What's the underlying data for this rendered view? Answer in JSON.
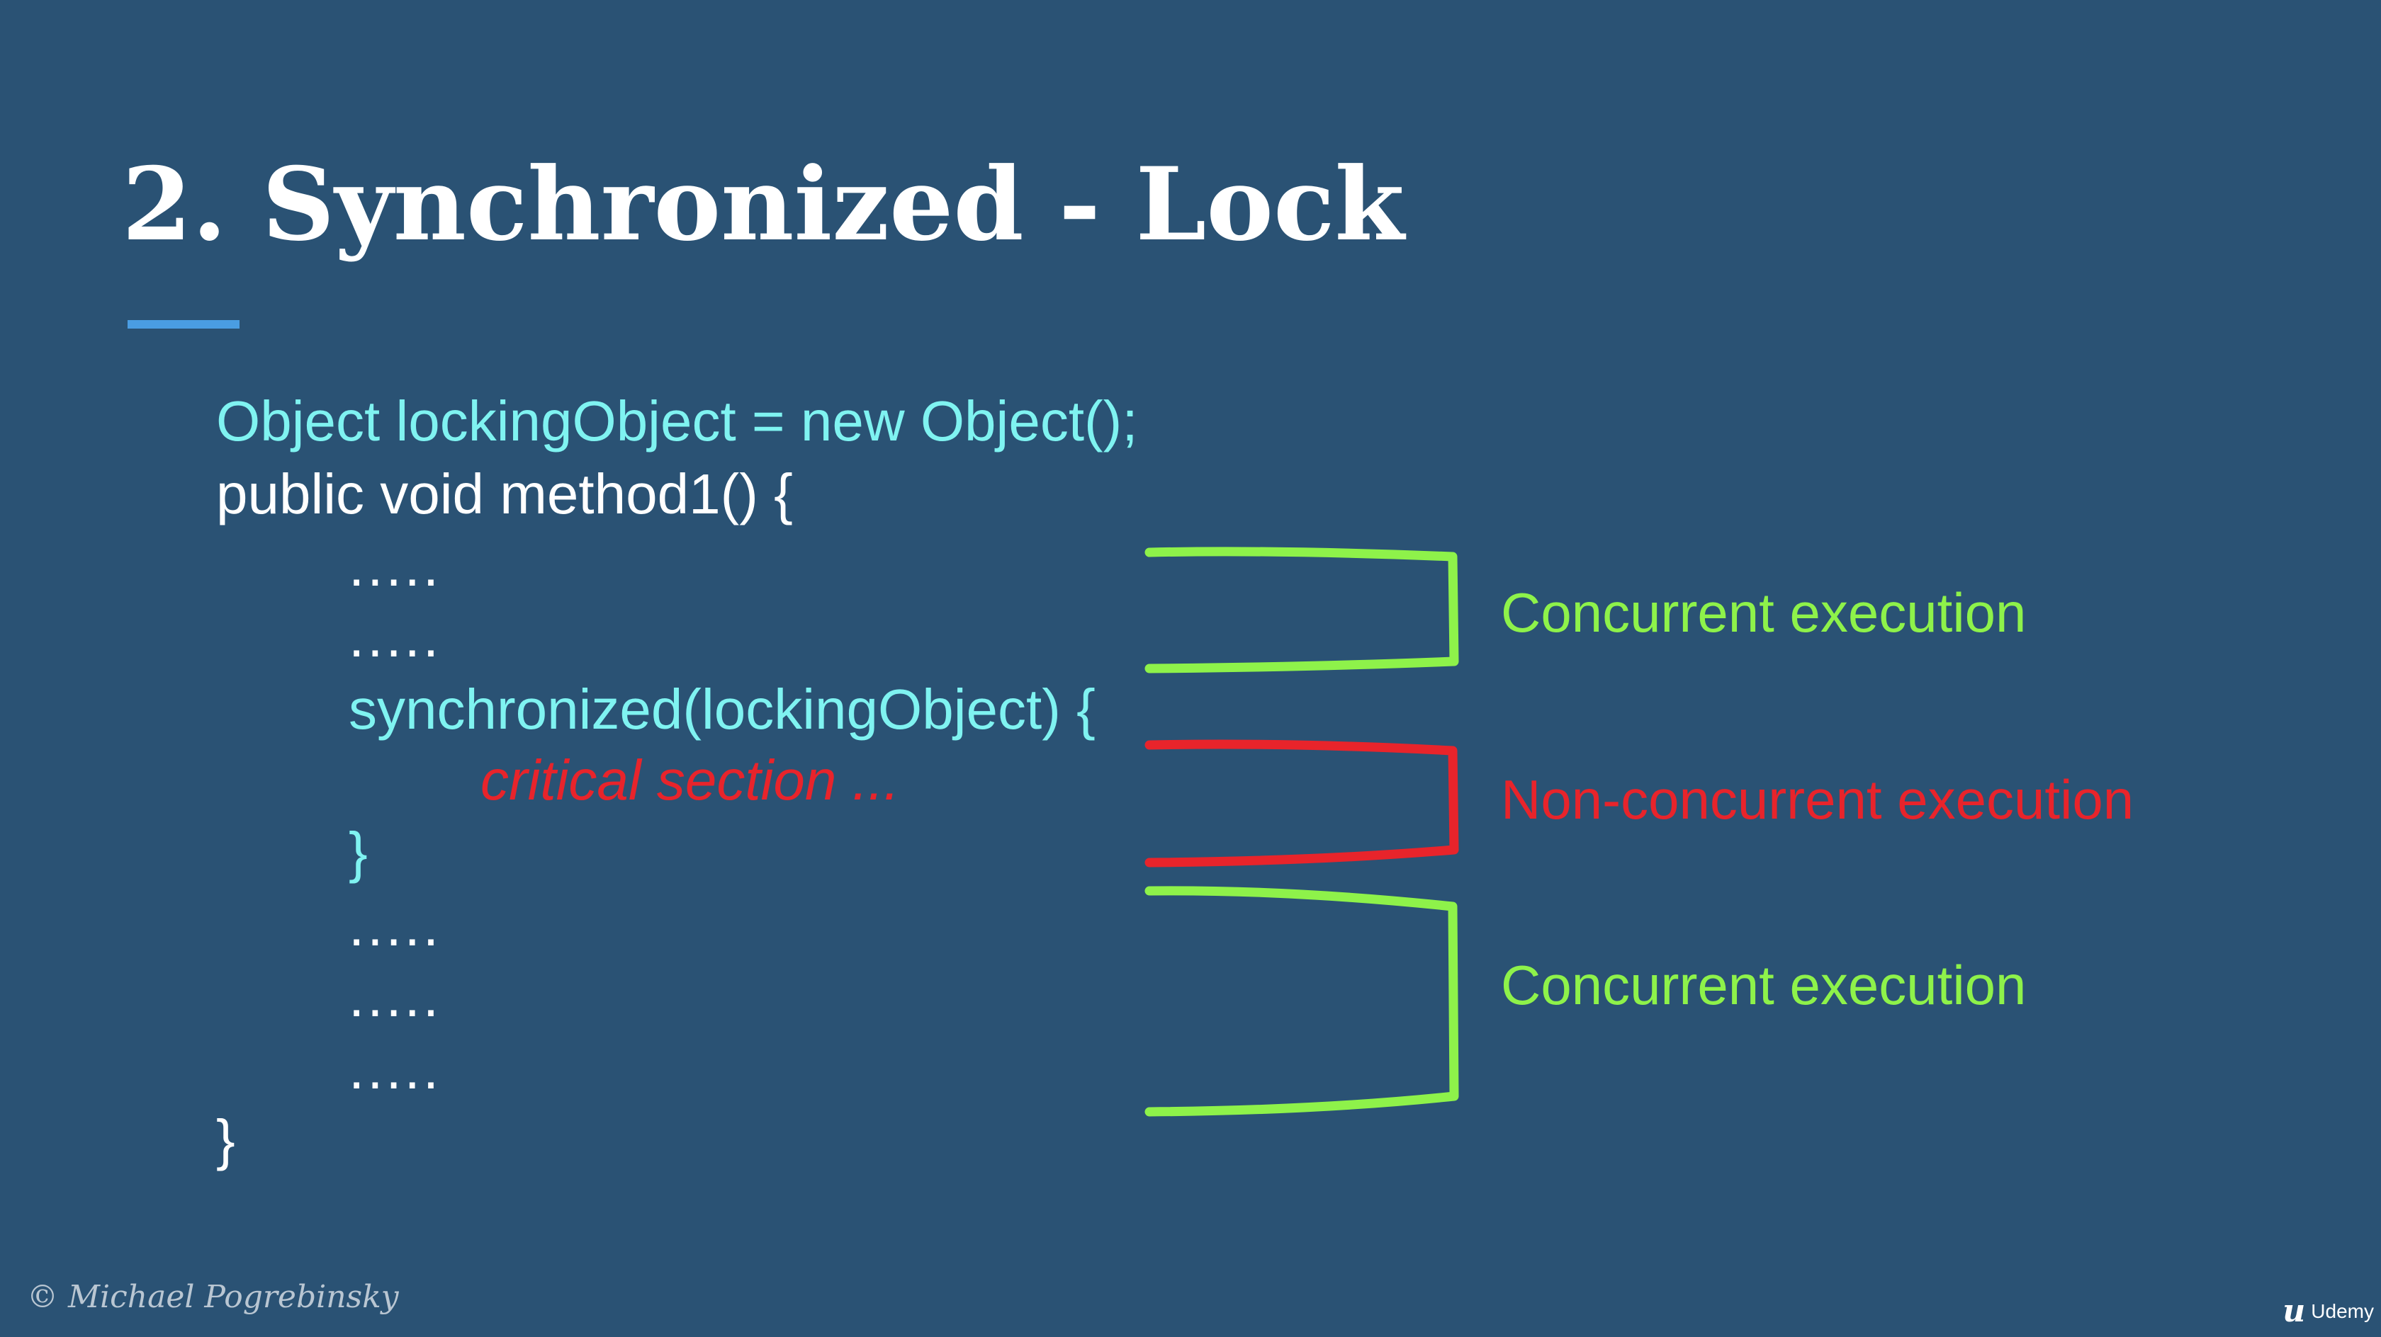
{
  "slide": {
    "title": "2. Synchronized - Lock",
    "code": {
      "line1": "Object lockingObject  = new Object();",
      "line2": "public void method1() {",
      "dots1": ".....",
      "dots2": ".....",
      "sync_line": "synchronized(lockingObject) {",
      "critical": "critical section   ...",
      "inner_close": "}",
      "dots3": ".....",
      "dots4": ".....",
      "dots5": ".....",
      "outer_close": "}"
    },
    "labels": {
      "concurrent_top": "Concurrent execution",
      "non_concurrent": "Non-concurrent execution",
      "concurrent_bottom": "Concurrent execution"
    },
    "footer": {
      "copyright": "© Michael Pogrebinsky",
      "brand": "Udemy"
    }
  },
  "colors": {
    "background": "#2a5274",
    "code_highlight": "#7ff3f1",
    "concurrent": "#8ef24a",
    "non_concurrent": "#e8242b",
    "accent_bar": "#4a9de2"
  }
}
